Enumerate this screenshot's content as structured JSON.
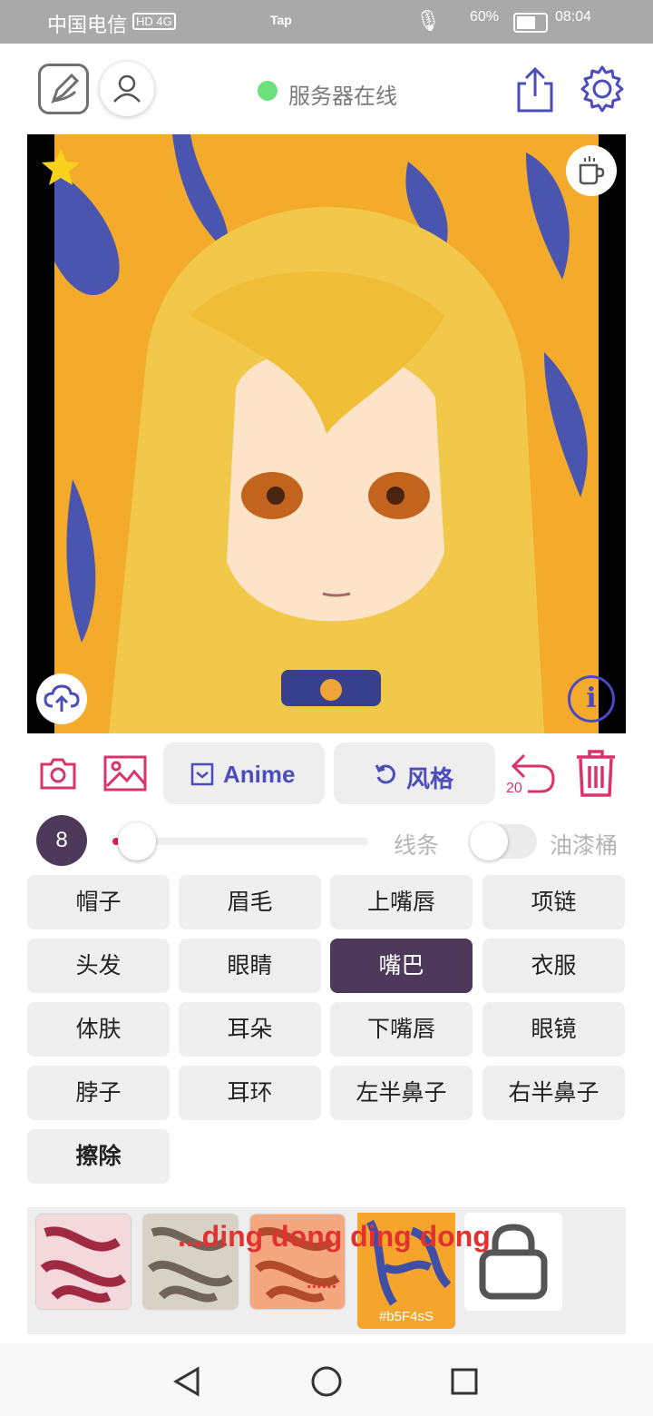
{
  "status_bar": {
    "carrier": "中国电信",
    "network": "HD 4G",
    "app_badge": "Tap",
    "battery": "60%",
    "time": "08:04"
  },
  "header": {
    "server_status": "服务器在线",
    "server_status_color": "#6be07b"
  },
  "actions": {
    "anime_label": "Anime",
    "style_label": "风格",
    "undo_count": "20"
  },
  "brush": {
    "size": "8",
    "line_label": "线条",
    "bucket_label": "油漆桶",
    "toggle_on": false
  },
  "labels": [
    {
      "text": "帽子"
    },
    {
      "text": "眉毛"
    },
    {
      "text": "上嘴唇"
    },
    {
      "text": "项链"
    },
    {
      "text": "头发"
    },
    {
      "text": "眼睛"
    },
    {
      "text": "嘴巴",
      "active": true
    },
    {
      "text": "衣服"
    },
    {
      "text": "体肤"
    },
    {
      "text": "耳朵"
    },
    {
      "text": "下嘴唇"
    },
    {
      "text": "眼镜"
    },
    {
      "text": "脖子"
    },
    {
      "text": "耳环"
    },
    {
      "text": "左半鼻子"
    },
    {
      "text": "右半鼻子"
    },
    {
      "text": "擦除"
    }
  ],
  "styles": {
    "selected_id": "#b5F4sS",
    "overlay_text": "...ding dong ding dong",
    "overlay_dots": "......"
  },
  "colors": {
    "accent": "#4a4dbb",
    "pink": "#d8346a",
    "active_label": "#4d3a5a"
  }
}
